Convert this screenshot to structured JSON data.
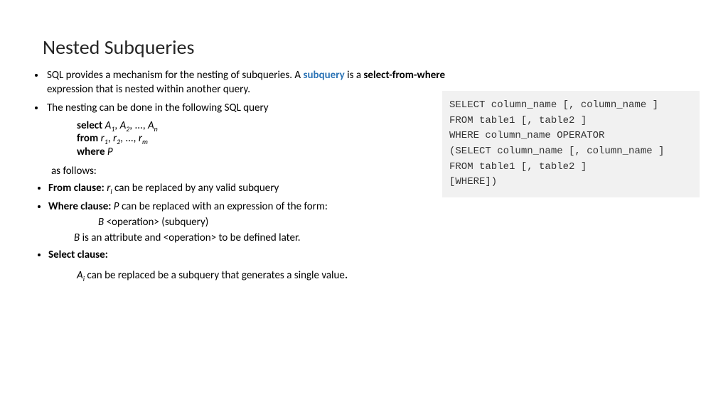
{
  "title": "Nested Subqueries",
  "b1a": "SQL provides a mechanism for the nesting of subqueries. A ",
  "term": "subquery",
  "b1b": " is a ",
  "b1c": "select-from-where",
  "b1d": " expression that is nested within another query.",
  "b2": "The nesting can be done in the following SQL query",
  "q_select": "select",
  "q_from": "from",
  "q_where_kw": "where",
  "q_where_val": "P",
  "as_follows": "as follows:",
  "fc_label": "From clause:",
  "fc_text": " can be replaced by any valid subquery",
  "wc_label": "Where clause:",
  "wc_text": " can be replaced with an expression of the form:",
  "wc_var": "P",
  "op_b": "B",
  "op_text": " <operation> (subquery)",
  "b_is": " is an attribute and <operation> to be defined later.",
  "sc_label": "Select clause:",
  "sc_text": " can be replaced be a subquery that generates a single value",
  "code": "SELECT column_name [, column_name ]\nFROM table1 [, table2 ]\nWHERE column_name OPERATOR\n(SELECT column_name [, column_name ]\nFROM table1 [, table2 ]\n[WHERE])",
  "A": "A",
  "r": "r",
  "ri": "r",
  "i": "i",
  "dot": "."
}
